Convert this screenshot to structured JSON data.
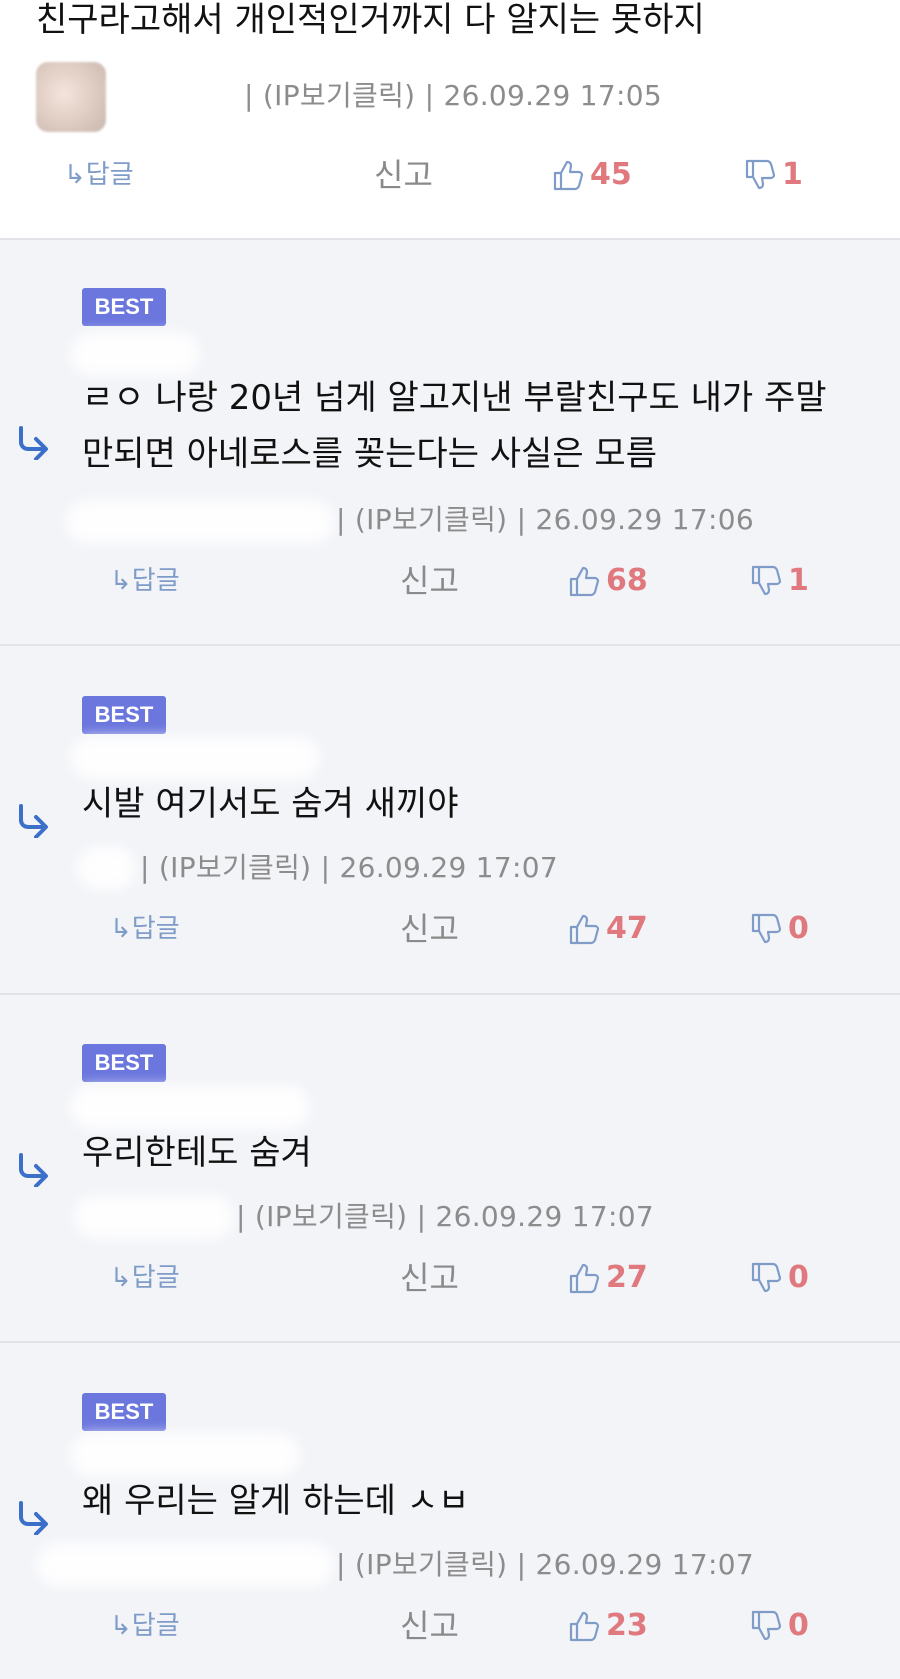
{
  "top_comment": {
    "text": "친구라고해서 개인적인거까지 다 알지는 못하지",
    "meta": "| (IP보기클릭) | 26.09.29 17:05",
    "reply_label": "↳답글",
    "report_label": "신고",
    "likes": "45",
    "dislikes": "1"
  },
  "best_badge": "BEST",
  "replies": [
    {
      "text_lines": [
        "ㄹㅇ 나랑 20년 넘게 알고지낸 부랄친구도 내가 주말",
        "만되면 아네로스를 꽂는다는 사실은 모름"
      ],
      "meta": "| (IP보기클릭) | 26.09.29 17:06",
      "reply_label": "↳답글",
      "report_label": "신고",
      "likes": "68",
      "dislikes": "1"
    },
    {
      "text_lines": [
        "시발 여기서도 숨겨 새끼야"
      ],
      "meta": "| (IP보기클릭) | 26.09.29 17:07",
      "reply_label": "↳답글",
      "report_label": "신고",
      "likes": "47",
      "dislikes": "0"
    },
    {
      "text_lines": [
        "우리한테도 숨겨"
      ],
      "meta": "| (IP보기클릭) | 26.09.29 17:07",
      "reply_label": "↳답글",
      "report_label": "신고",
      "likes": "27",
      "dislikes": "0"
    },
    {
      "text_lines": [
        "왜 우리는 알게 하는데 ㅅㅂ"
      ],
      "meta": "| (IP보기클릭) | 26.09.29 17:07",
      "reply_label": "↳답글",
      "report_label": "신고",
      "likes": "23",
      "dislikes": "0"
    }
  ],
  "colors": {
    "best_badge": "#6c77de",
    "count": "#e0797e",
    "thumb_up": "#7f9cc9",
    "reply_arrow": "#3b6fc9"
  }
}
